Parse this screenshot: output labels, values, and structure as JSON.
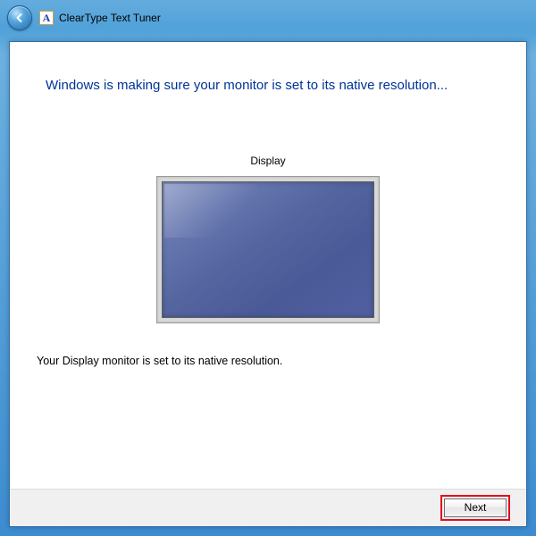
{
  "window": {
    "title": "ClearType Text Tuner",
    "app_icon_glyph": "A"
  },
  "main": {
    "heading": "Windows is making sure your monitor is set to its native resolution...",
    "display_label": "Display",
    "status_text": "Your Display monitor is set to its native resolution."
  },
  "footer": {
    "next_label": "Next"
  }
}
